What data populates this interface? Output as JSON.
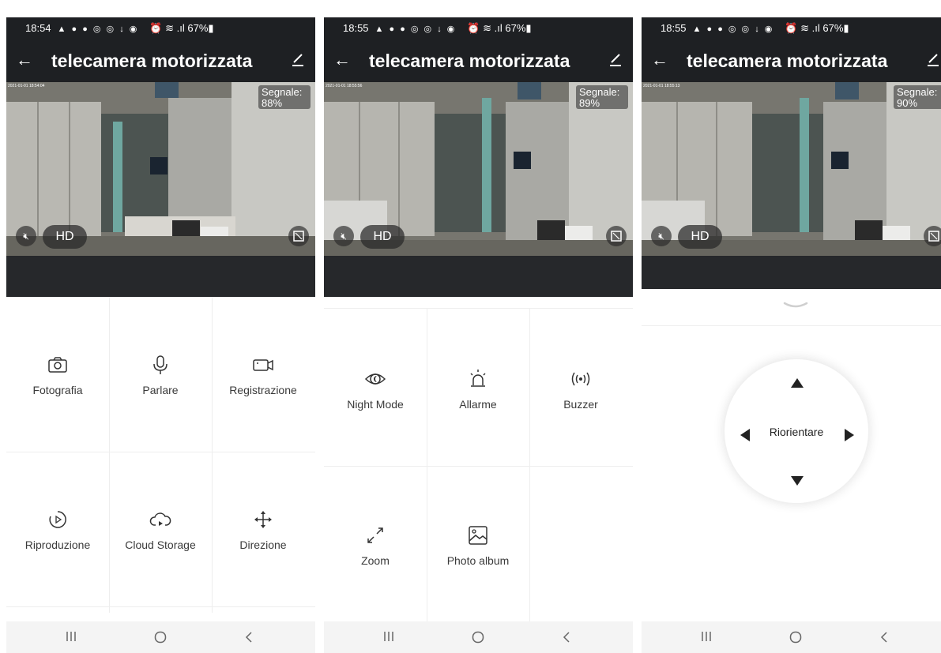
{
  "screens": [
    {
      "status_time": "18:54",
      "status_icons": "▲ ● ● ◎ ◎ ↓ ◉",
      "battery": "⏰ ≋ .ıl 67%▮",
      "title": "telecamera motorizzata",
      "osd": "2021-01-01 18:54:04",
      "signal": "Segnale:\n88%",
      "hd": "HD",
      "controls": [
        {
          "icon": "camera-icon",
          "label": "Fotografia"
        },
        {
          "icon": "microphone-icon",
          "label": "Parlare"
        },
        {
          "icon": "video-record-icon",
          "label": "Registrazione"
        },
        {
          "icon": "playback-icon",
          "label": "Riproduzione"
        },
        {
          "icon": "cloud-storage-icon",
          "label": "Cloud Storage"
        },
        {
          "icon": "direction-icon",
          "label": "Direzione"
        }
      ]
    },
    {
      "status_time": "18:55",
      "status_icons": "▲ ● ● ◎ ◎ ↓ ◉",
      "battery": "⏰ ≋ .ıl 67%▮",
      "title": "telecamera motorizzata",
      "osd": "2021-01-01 18:55:56",
      "signal": "Segnale:\n89%",
      "hd": "HD",
      "controls": [
        {
          "icon": "night-mode-icon",
          "label": "Night Mode"
        },
        {
          "icon": "alarm-icon",
          "label": "Allarme"
        },
        {
          "icon": "buzzer-icon",
          "label": "Buzzer"
        },
        {
          "icon": "zoom-icon",
          "label": "Zoom"
        },
        {
          "icon": "photo-album-icon",
          "label": "Photo album"
        }
      ]
    },
    {
      "status_time": "18:55",
      "status_icons": "▲ ● ● ◎ ◎ ↓ ◉",
      "battery": "⏰ ≋ .ıl 67%▮",
      "title": "telecamera motorizzata",
      "osd": "2021-01-01 18:55:13",
      "signal": "Segnale:\n90%",
      "hd": "HD",
      "ptz": {
        "center_label": "Riorientare"
      }
    }
  ],
  "icon_names": {
    "mute": "speaker-mute-icon",
    "fullscreen": "fullscreen-icon",
    "back": "back-arrow-icon",
    "edit": "edit-pencil-icon"
  },
  "colors": {
    "header_bg": "#1e2023",
    "strip_bg": "#26282b",
    "nav_bg": "#f4f4f4",
    "text": "#3a3a3a"
  }
}
